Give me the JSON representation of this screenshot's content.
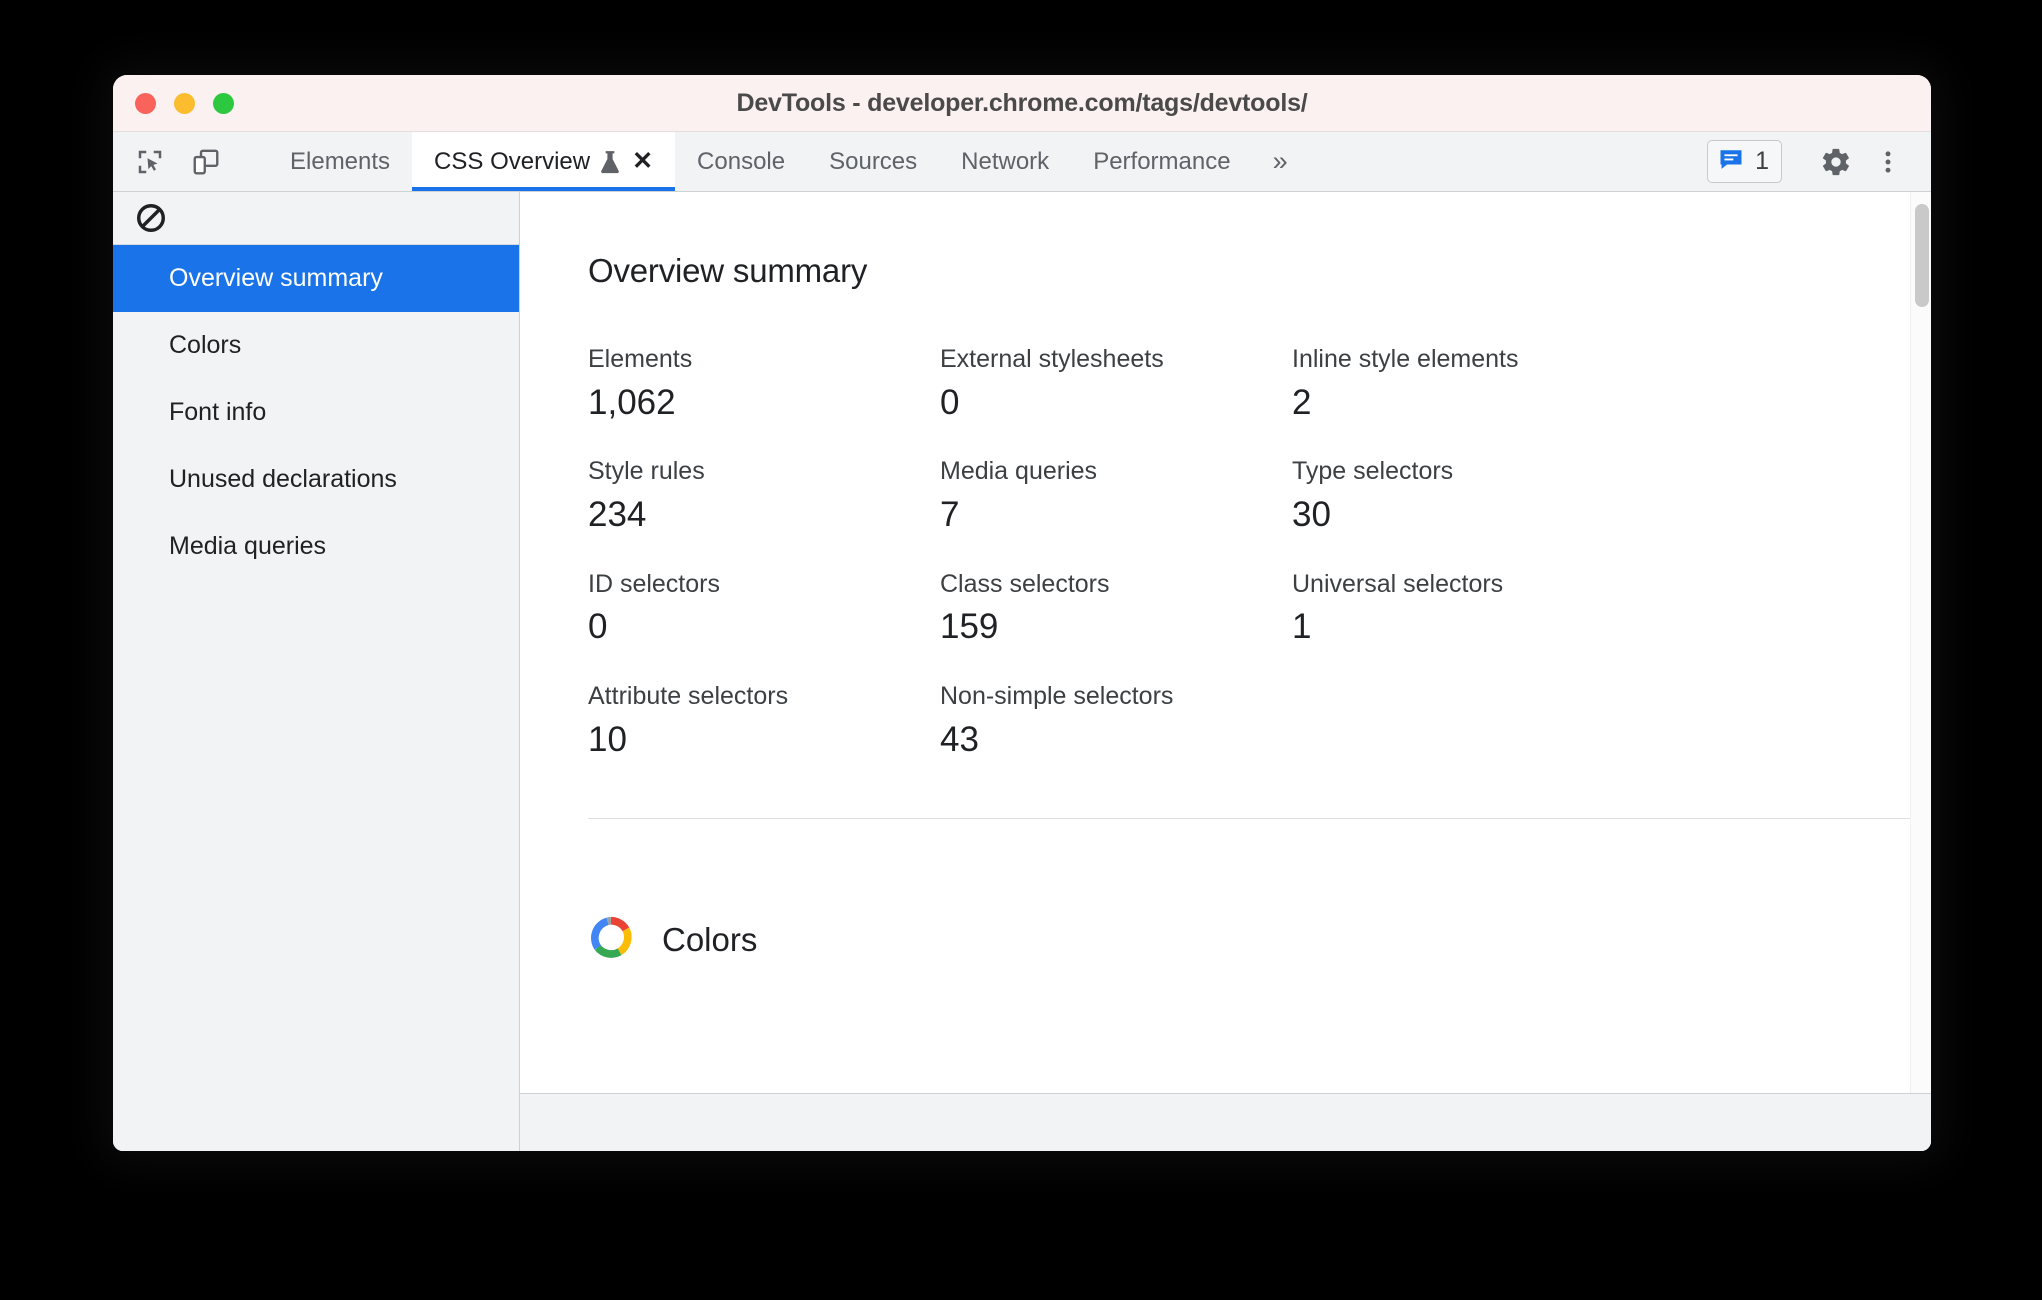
{
  "window": {
    "title": "DevTools - developer.chrome.com/tags/devtools/",
    "traffic_lights": [
      "close-red",
      "minimize-yellow",
      "zoom-green"
    ],
    "colors": {
      "red": "#f9635b",
      "yellow": "#fbbd2e",
      "green": "#2bc840",
      "titlebar_bg": "#fbf1f0"
    }
  },
  "toolbar": {
    "inspect_icon": "inspect-cursor-icon",
    "device_icon": "device-toolbar-icon",
    "tabs": [
      {
        "label": "Elements",
        "active": false
      },
      {
        "label": "CSS Overview",
        "active": true,
        "experiment_icon": "flask-icon",
        "close_label": "✕"
      },
      {
        "label": "Console",
        "active": false
      },
      {
        "label": "Sources",
        "active": false
      },
      {
        "label": "Network",
        "active": false
      },
      {
        "label": "Performance",
        "active": false
      }
    ],
    "overflow_label": "»",
    "issues": {
      "icon": "issues-message-icon",
      "count": "1",
      "color": "#1a73e8"
    },
    "settings_icon": "gear-icon",
    "more_icon": "three-dot-menu-icon",
    "accent": "#1a73e8"
  },
  "sidebar": {
    "clear_icon": "clear-block-icon",
    "items": [
      {
        "label": "Overview summary",
        "selected": true
      },
      {
        "label": "Colors",
        "selected": false
      },
      {
        "label": "Font info",
        "selected": false
      },
      {
        "label": "Unused declarations",
        "selected": false
      },
      {
        "label": "Media queries",
        "selected": false
      }
    ]
  },
  "main": {
    "summary_title": "Overview summary",
    "stats": [
      {
        "label": "Elements",
        "value": "1,062"
      },
      {
        "label": "External stylesheets",
        "value": "0"
      },
      {
        "label": "Inline style elements",
        "value": "2"
      },
      {
        "label": "Style rules",
        "value": "234"
      },
      {
        "label": "Media queries",
        "value": "7"
      },
      {
        "label": "Type selectors",
        "value": "30"
      },
      {
        "label": "ID selectors",
        "value": "0"
      },
      {
        "label": "Class selectors",
        "value": "159"
      },
      {
        "label": "Universal selectors",
        "value": "1"
      },
      {
        "label": "Attribute selectors",
        "value": "10"
      },
      {
        "label": "Non-simple selectors",
        "value": "43"
      }
    ],
    "colors_section": {
      "title": "Colors",
      "icon": "color-wheel-icon",
      "wheel_colors": [
        "#4285f4",
        "#ea4335",
        "#fbbc05",
        "#34a853",
        "#9aa0a6"
      ]
    }
  }
}
